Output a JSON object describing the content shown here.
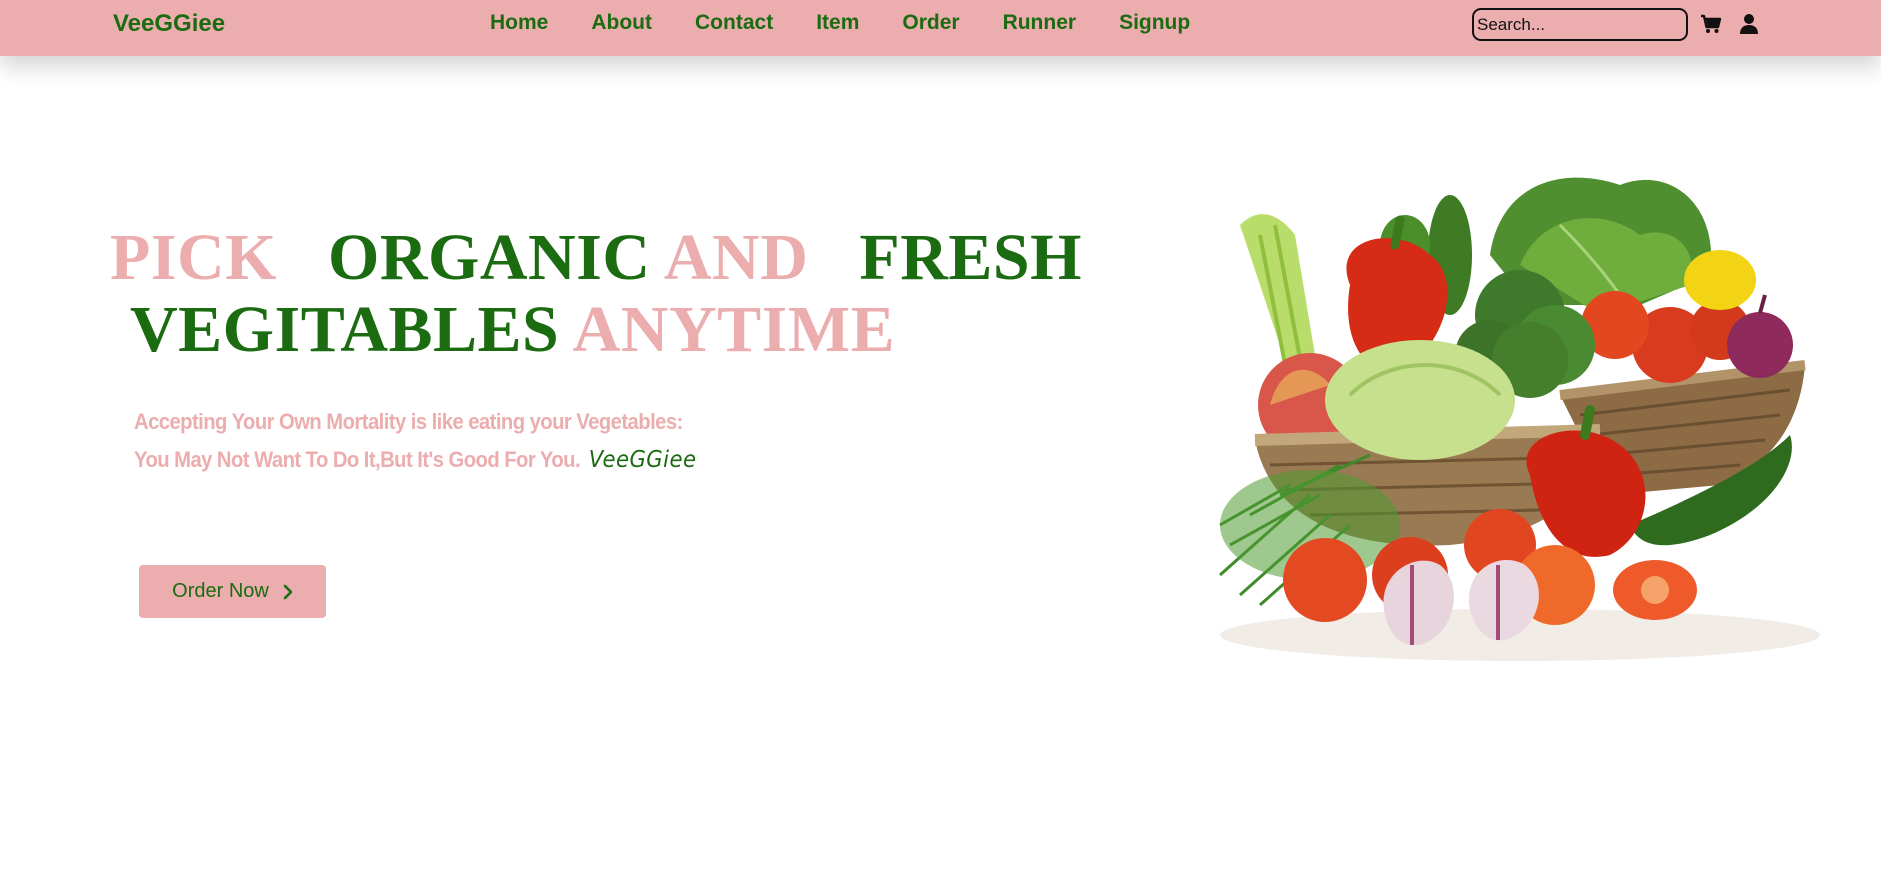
{
  "navbar": {
    "logo": "VeeGGiee",
    "links": [
      "Home",
      "About",
      "Contact",
      "Item",
      "Order",
      "Runner",
      "Signup"
    ],
    "search_placeholder": "Search...",
    "icons": [
      "cart-icon",
      "user-icon"
    ]
  },
  "hero": {
    "title_words": [
      "PICK",
      "ORGANIC",
      "AND",
      "FRESH",
      "VEGITABLES",
      "ANYTIME"
    ],
    "subtitle_line1": "Accepting Your Own Mortality is like eating your Vegetables:",
    "subtitle_line2": "You May Not Want To Do It,But It's Good For You.",
    "subtitle_brand": "VeeGGiee",
    "cta_label": "Order Now"
  },
  "colors": {
    "pink": "#ebadae",
    "green": "#1b6b11",
    "background": "#ffffff"
  }
}
